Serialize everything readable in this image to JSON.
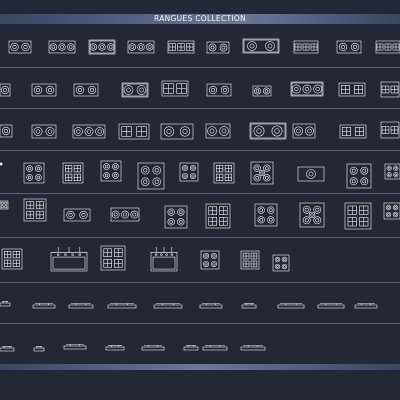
{
  "drawing": {
    "title": "RANGUES COLLECTION",
    "line_color": "#f0f2f6",
    "background_color": "#232834",
    "header_color": "#5a6685"
  }
}
